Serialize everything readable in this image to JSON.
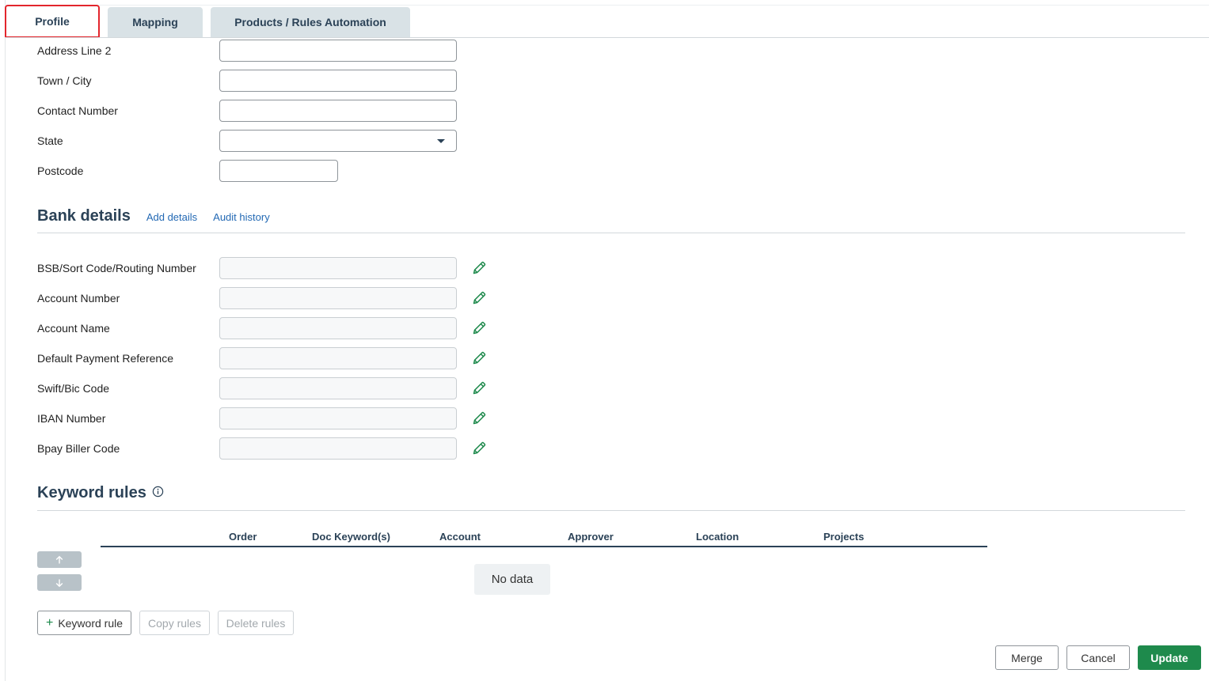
{
  "tabs": [
    {
      "label": "Profile",
      "active": true
    },
    {
      "label": "Mapping",
      "active": false
    },
    {
      "label": "Products / Rules Automation",
      "active": false
    }
  ],
  "address": {
    "address_line_2": {
      "label": "Address Line 2",
      "value": ""
    },
    "town_city": {
      "label": "Town / City",
      "value": ""
    },
    "contact_number": {
      "label": "Contact Number",
      "value": ""
    },
    "state": {
      "label": "State",
      "selected": ""
    },
    "postcode": {
      "label": "Postcode",
      "value": ""
    }
  },
  "bank": {
    "title": "Bank details",
    "add_details_link": "Add details",
    "audit_history_link": "Audit history",
    "fields": [
      {
        "label": "BSB/Sort Code/Routing Number",
        "value": ""
      },
      {
        "label": "Account Number",
        "value": ""
      },
      {
        "label": "Account Name",
        "value": ""
      },
      {
        "label": "Default Payment Reference",
        "value": ""
      },
      {
        "label": "Swift/Bic Code",
        "value": ""
      },
      {
        "label": "IBAN Number",
        "value": ""
      },
      {
        "label": "Bpay Biller Code",
        "value": ""
      }
    ],
    "edit_icon": "pencil-icon"
  },
  "keyword_rules": {
    "title": "Keyword rules",
    "info_icon": "info-icon",
    "columns": [
      "Order",
      "Doc Keyword(s)",
      "Account",
      "Approver",
      "Location",
      "Projects"
    ],
    "rows": [],
    "empty_text": "No data",
    "move_up_icon": "arrow-up-icon",
    "move_down_icon": "arrow-down-icon",
    "add_rule_label": "Keyword rule",
    "copy_rules_label": "Copy rules",
    "delete_rules_label": "Delete rules"
  },
  "footer": {
    "merge_label": "Merge",
    "cancel_label": "Cancel",
    "update_label": "Update"
  },
  "colors": {
    "heading": "#2b4257",
    "link": "#2369b4",
    "primary": "#1e8a4c",
    "active_tab_outline": "#e3262d"
  }
}
